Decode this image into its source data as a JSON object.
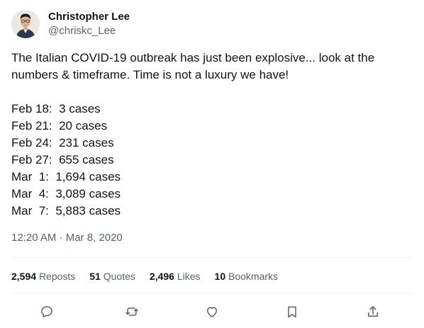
{
  "author": {
    "display_name": "Christopher Lee",
    "handle": "@chriskc_Lee"
  },
  "tweet": {
    "intro": "The Italian COVID-19 outbreak has just been explosive... look at the numbers & timeframe. Time is not a luxury we have!",
    "case_lines": [
      "Feb 18:  3 cases",
      "Feb 21:  20 cases",
      "Feb 24:  231 cases",
      "Feb 27:  655 cases",
      "Mar  1:  1,694 cases",
      "Mar  4:  3,089 cases",
      "Mar  7:  5,883 cases"
    ],
    "timestamp": "12:20 AM · Mar 8, 2020"
  },
  "stats": {
    "reposts": {
      "count": "2,594",
      "label": "Reposts"
    },
    "quotes": {
      "count": "51",
      "label": "Quotes"
    },
    "likes": {
      "count": "2,496",
      "label": "Likes"
    },
    "bookmarks": {
      "count": "10",
      "label": "Bookmarks"
    }
  },
  "actions": {
    "icons": [
      "reply-icon",
      "repost-icon",
      "like-icon",
      "bookmark-icon",
      "share-icon"
    ]
  },
  "colors": {
    "text_primary": "#0f1419",
    "text_secondary": "#536471",
    "divider": "#eff3f4"
  }
}
